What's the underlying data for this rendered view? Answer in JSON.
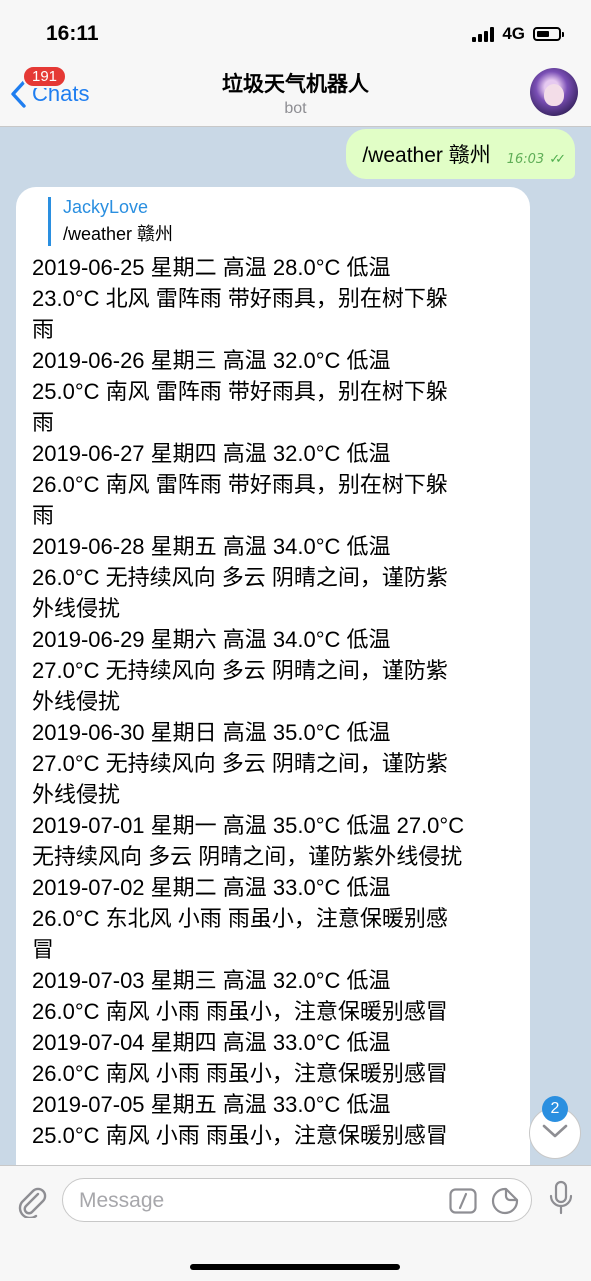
{
  "status_bar": {
    "time": "16:11",
    "network": "4G"
  },
  "nav": {
    "back_label": "Chats",
    "unread_count": "191",
    "title": "垃圾天气机器人",
    "subtitle": "bot"
  },
  "outgoing": {
    "text": "/weather 赣州",
    "time": "16:03"
  },
  "incoming": {
    "reply_author": "JackyLove",
    "reply_text": "/weather 赣州",
    "lines": [
      "2019-06-25 星期二 高温 28.0°C 低温",
      "23.0°C 北风 雷阵雨 带好雨具，别在树下躲",
      "雨",
      "2019-06-26 星期三 高温 32.0°C 低温",
      "25.0°C 南风 雷阵雨 带好雨具，别在树下躲",
      "雨",
      "2019-06-27 星期四 高温 32.0°C 低温",
      "26.0°C 南风 雷阵雨 带好雨具，别在树下躲",
      "雨",
      "2019-06-28 星期五 高温 34.0°C 低温",
      "26.0°C 无持续风向 多云 阴晴之间，谨防紫",
      "外线侵扰",
      "2019-06-29 星期六 高温 34.0°C 低温",
      "27.0°C 无持续风向 多云 阴晴之间，谨防紫",
      "外线侵扰",
      "2019-06-30 星期日 高温 35.0°C 低温",
      "27.0°C 无持续风向 多云 阴晴之间，谨防紫",
      "外线侵扰",
      "2019-07-01 星期一 高温 35.0°C 低温 27.0°C",
      "无持续风向 多云 阴晴之间，谨防紫外线侵扰",
      "2019-07-02 星期二 高温 33.0°C 低温",
      "26.0°C 东北风 小雨 雨虽小，注意保暖别感",
      "冒",
      "2019-07-03 星期三 高温 32.0°C 低温",
      "26.0°C 南风 小雨 雨虽小，注意保暖别感冒",
      "2019-07-04 星期四 高温 33.0°C 低温",
      "26.0°C 南风 小雨 雨虽小，注意保暖别感冒",
      "2019-07-05 星期五 高温 33.0°C 低温",
      "25.0°C 南风 小雨 雨虽小，注意保暖别感冒"
    ]
  },
  "scroll_badge": "2",
  "input": {
    "placeholder": "Message"
  },
  "icons": {
    "back": "chevron-left-icon",
    "attach": "paperclip-icon",
    "commands": "slash-command-icon",
    "sticker": "sticker-icon",
    "mic": "microphone-icon",
    "scroll_down": "chevron-down-icon",
    "read": "double-check-icon"
  },
  "colors": {
    "accent": "#1f7ef0",
    "badge_red": "#e53935",
    "outgoing_bubble": "#e1fec6",
    "chat_background": "#c9d8e6"
  }
}
